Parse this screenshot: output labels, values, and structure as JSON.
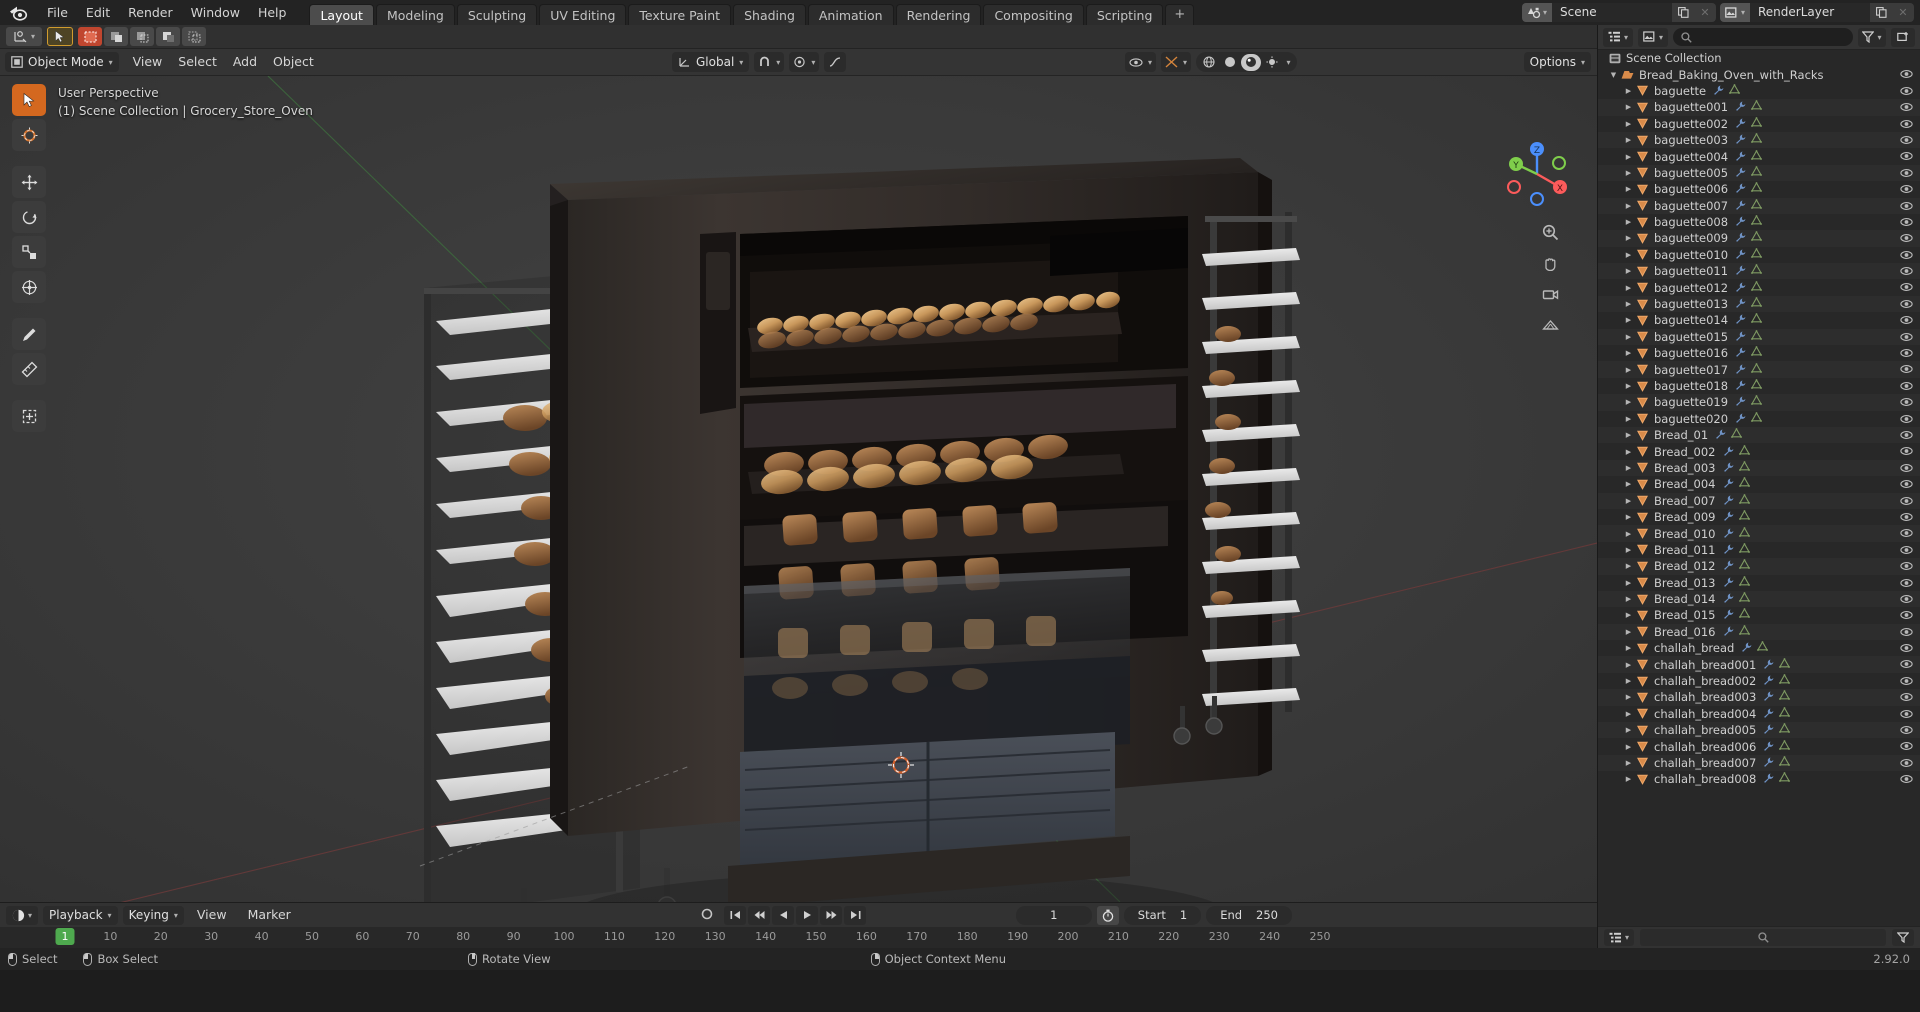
{
  "app": {
    "name": "Blender",
    "version_text": "2.92.0"
  },
  "topbar": {
    "logo_icon": "blender-logo-icon",
    "menus": [
      "File",
      "Edit",
      "Render",
      "Window",
      "Help"
    ],
    "workspace_tabs": [
      {
        "label": "Layout",
        "active": true
      },
      {
        "label": "Modeling",
        "active": false
      },
      {
        "label": "Sculpting",
        "active": false
      },
      {
        "label": "UV Editing",
        "active": false
      },
      {
        "label": "Texture Paint",
        "active": false
      },
      {
        "label": "Shading",
        "active": false
      },
      {
        "label": "Animation",
        "active": false
      },
      {
        "label": "Rendering",
        "active": false
      },
      {
        "label": "Compositing",
        "active": false
      },
      {
        "label": "Scripting",
        "active": false
      }
    ],
    "add_workspace_label": "+",
    "scene_icon": "scene-icon",
    "scene_name": "Scene",
    "new_scene_icon": "duplicate-icon",
    "remove_scene_icon": "x-icon",
    "viewlayer_icon": "viewlayer-icon",
    "viewlayer_name": "RenderLayer",
    "new_viewlayer_icon": "duplicate-icon",
    "remove_viewlayer_icon": "x-icon"
  },
  "tool_settings_header": {
    "transform_pivot_icon": "transform-pivot-icon",
    "cursor_icon": "cursor-icon",
    "select_mode_icons": [
      "select-set-icon",
      "select-extend-icon",
      "select-subtract-icon",
      "select-invert-icon",
      "select-intersect-icon"
    ]
  },
  "viewport_header": {
    "mode_icon": "object-mode-icon",
    "mode_label": "Object Mode",
    "menus": [
      "View",
      "Select",
      "Add",
      "Object"
    ],
    "transform_orientation_icon": "orientation-icon",
    "transform_orientation_label": "Global",
    "snap_icon": "magnet-icon",
    "proportional_icon": "proportional-edit-icon",
    "proportional_falloff_icon": "falloff-curve-icon",
    "options_label": "Options",
    "visibility_icon": "visibility-icon",
    "xray_icon": "xray-icon",
    "shading_modes": [
      "wireframe",
      "solid",
      "material-preview",
      "rendered"
    ],
    "shading_active": "material-preview",
    "gizmo_icon": "gizmo-icon",
    "overlays_icon": "overlays-icon"
  },
  "viewport": {
    "perspective_label": "User Perspective",
    "scene_info_label": "(1) Scene Collection | Grocery_Store_Oven",
    "tools": [
      {
        "icon": "tweak-tool-icon",
        "selected": true
      },
      {
        "icon": "cursor-tool-icon",
        "selected": false
      },
      {
        "icon": "move-tool-icon",
        "selected": false
      },
      {
        "icon": "rotate-tool-icon",
        "selected": false
      },
      {
        "icon": "scale-tool-icon",
        "selected": false
      },
      {
        "icon": "transform-tool-icon",
        "selected": false
      },
      {
        "icon": "annotate-tool-icon",
        "selected": false
      },
      {
        "icon": "measure-tool-icon",
        "selected": false
      },
      {
        "icon": "add-cube-tool-icon",
        "selected": false
      }
    ],
    "nav_gizmo": {
      "axes": [
        "X",
        "Y",
        "Z"
      ],
      "x_color": "#fc5b5b",
      "y_color": "#7fce4b",
      "z_color": "#4b8ffc"
    },
    "side_icons": [
      "zoom-icon",
      "hand-icon",
      "camera-icon",
      "grid-icon"
    ],
    "cursor_3d_icon": "3d-cursor-icon"
  },
  "timeline": {
    "editor_icon": "timeline-editor-icon",
    "menus": [
      "Playback",
      "Keying",
      "View",
      "Marker"
    ],
    "auto_key_icon": "record-icon",
    "transport_icons": [
      "jump-start",
      "prev-keyframe",
      "play-reverse",
      "play",
      "next-keyframe",
      "jump-end"
    ],
    "current_frame": "1",
    "use_preview_icon": "stopwatch-icon",
    "start_label": "Start",
    "start_value": "1",
    "end_label": "End",
    "end_value": "250",
    "ticks": [
      10,
      20,
      30,
      40,
      50,
      60,
      70,
      80,
      90,
      100,
      110,
      120,
      130,
      140,
      150,
      160,
      170,
      180,
      190,
      200,
      210,
      220,
      230,
      240,
      250
    ],
    "playhead_frame": "1"
  },
  "outliner": {
    "display_mode_icon": "outliner-display-icon",
    "filter_id_icon": "id-type-icon",
    "search_icon": "search-icon",
    "search_placeholder": "",
    "filter_icon": "funnel-icon",
    "new_collection_icon": "new-collection-icon",
    "root": {
      "icon": "scene-collection-icon",
      "label": "Scene Collection"
    },
    "collection": {
      "icon": "collection-icon",
      "label": "Bread_Baking_Oven_with_Racks",
      "expanded": true
    },
    "item_icon": "mesh-object-icon",
    "modifier_icon": "wrench-icon",
    "mesh_data_icon": "mesh-data-icon",
    "eye_icon": "eye-icon",
    "items": [
      "baguette",
      "baguette001",
      "baguette002",
      "baguette003",
      "baguette004",
      "baguette005",
      "baguette006",
      "baguette007",
      "baguette008",
      "baguette009",
      "baguette010",
      "baguette011",
      "baguette012",
      "baguette013",
      "baguette014",
      "baguette015",
      "baguette016",
      "baguette017",
      "baguette018",
      "baguette019",
      "baguette020",
      "Bread_01",
      "Bread_002",
      "Bread_003",
      "Bread_004",
      "Bread_007",
      "Bread_009",
      "Bread_010",
      "Bread_011",
      "Bread_012",
      "Bread_013",
      "Bread_014",
      "Bread_015",
      "Bread_016",
      "challah_bread",
      "challah_bread001",
      "challah_bread002",
      "challah_bread003",
      "challah_bread004",
      "challah_bread005",
      "challah_bread006",
      "challah_bread007",
      "challah_bread008"
    ],
    "footer": {
      "editor_icon": "outliner-editor-icon",
      "dropdown_icon": "chevron-down-icon",
      "search_icon": "search-icon",
      "filter_icon": "filter-icon"
    }
  },
  "statusbar": {
    "hints": [
      {
        "mouse": "lmb",
        "label": "Select"
      },
      {
        "mouse": "lmb-drag",
        "label": "Box Select"
      },
      {
        "mouse": "mmb",
        "label": "Rotate View"
      },
      {
        "mouse": "rmb",
        "label": "Object Context Menu"
      }
    ],
    "version": "2.92.0"
  }
}
